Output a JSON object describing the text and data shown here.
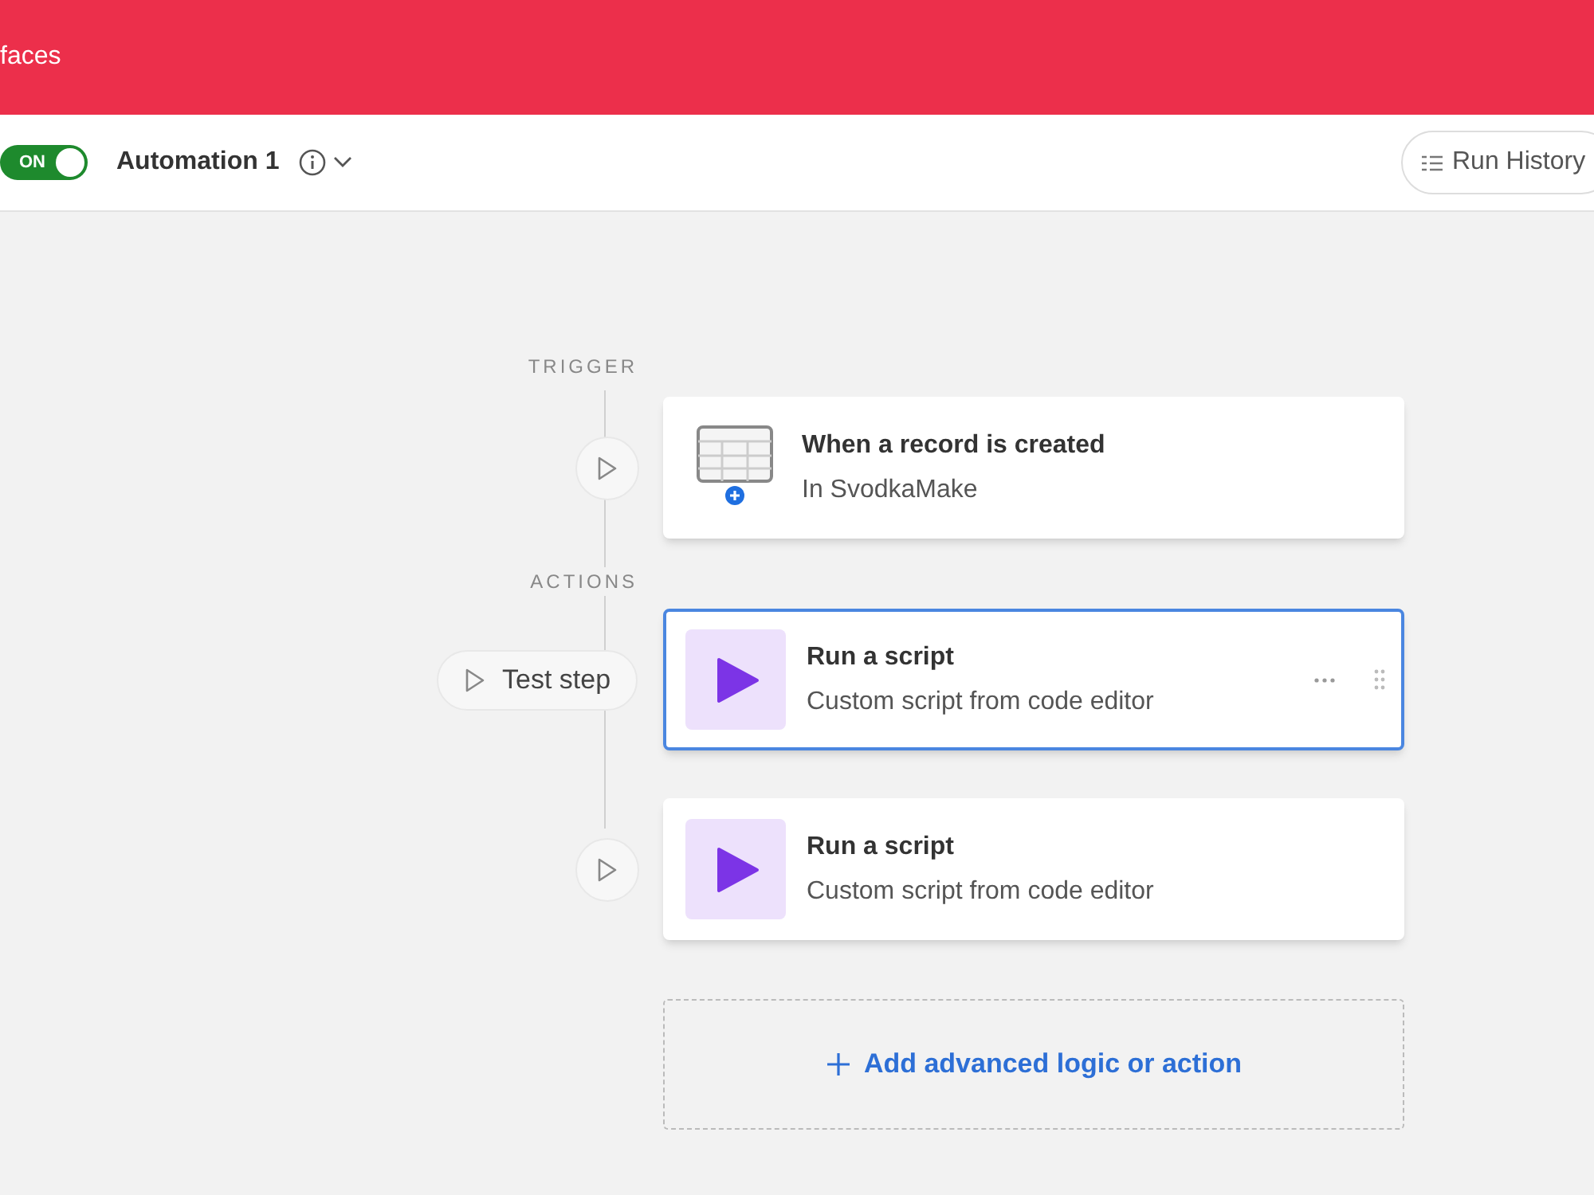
{
  "header": {
    "title": "faces"
  },
  "toolbar": {
    "toggle": {
      "label": "ON",
      "on": true
    },
    "automation_name": "Automation 1",
    "run_history": "Run History"
  },
  "sections": [
    {
      "label": "TRIGGER",
      "steps": [
        {
          "kind": "trigger",
          "title": "When a record is created",
          "subtitle": "In SvodkaMake",
          "selected": false
        }
      ]
    },
    {
      "label": "ACTIONS",
      "steps": [
        {
          "kind": "script",
          "title": "Run a script",
          "subtitle": "Custom script from code editor",
          "selected": true,
          "test_label": "Test step"
        },
        {
          "kind": "script",
          "title": "Run a script",
          "subtitle": "Custom script from code editor",
          "selected": false
        }
      ]
    }
  ],
  "add_action": "Add advanced logic or action"
}
